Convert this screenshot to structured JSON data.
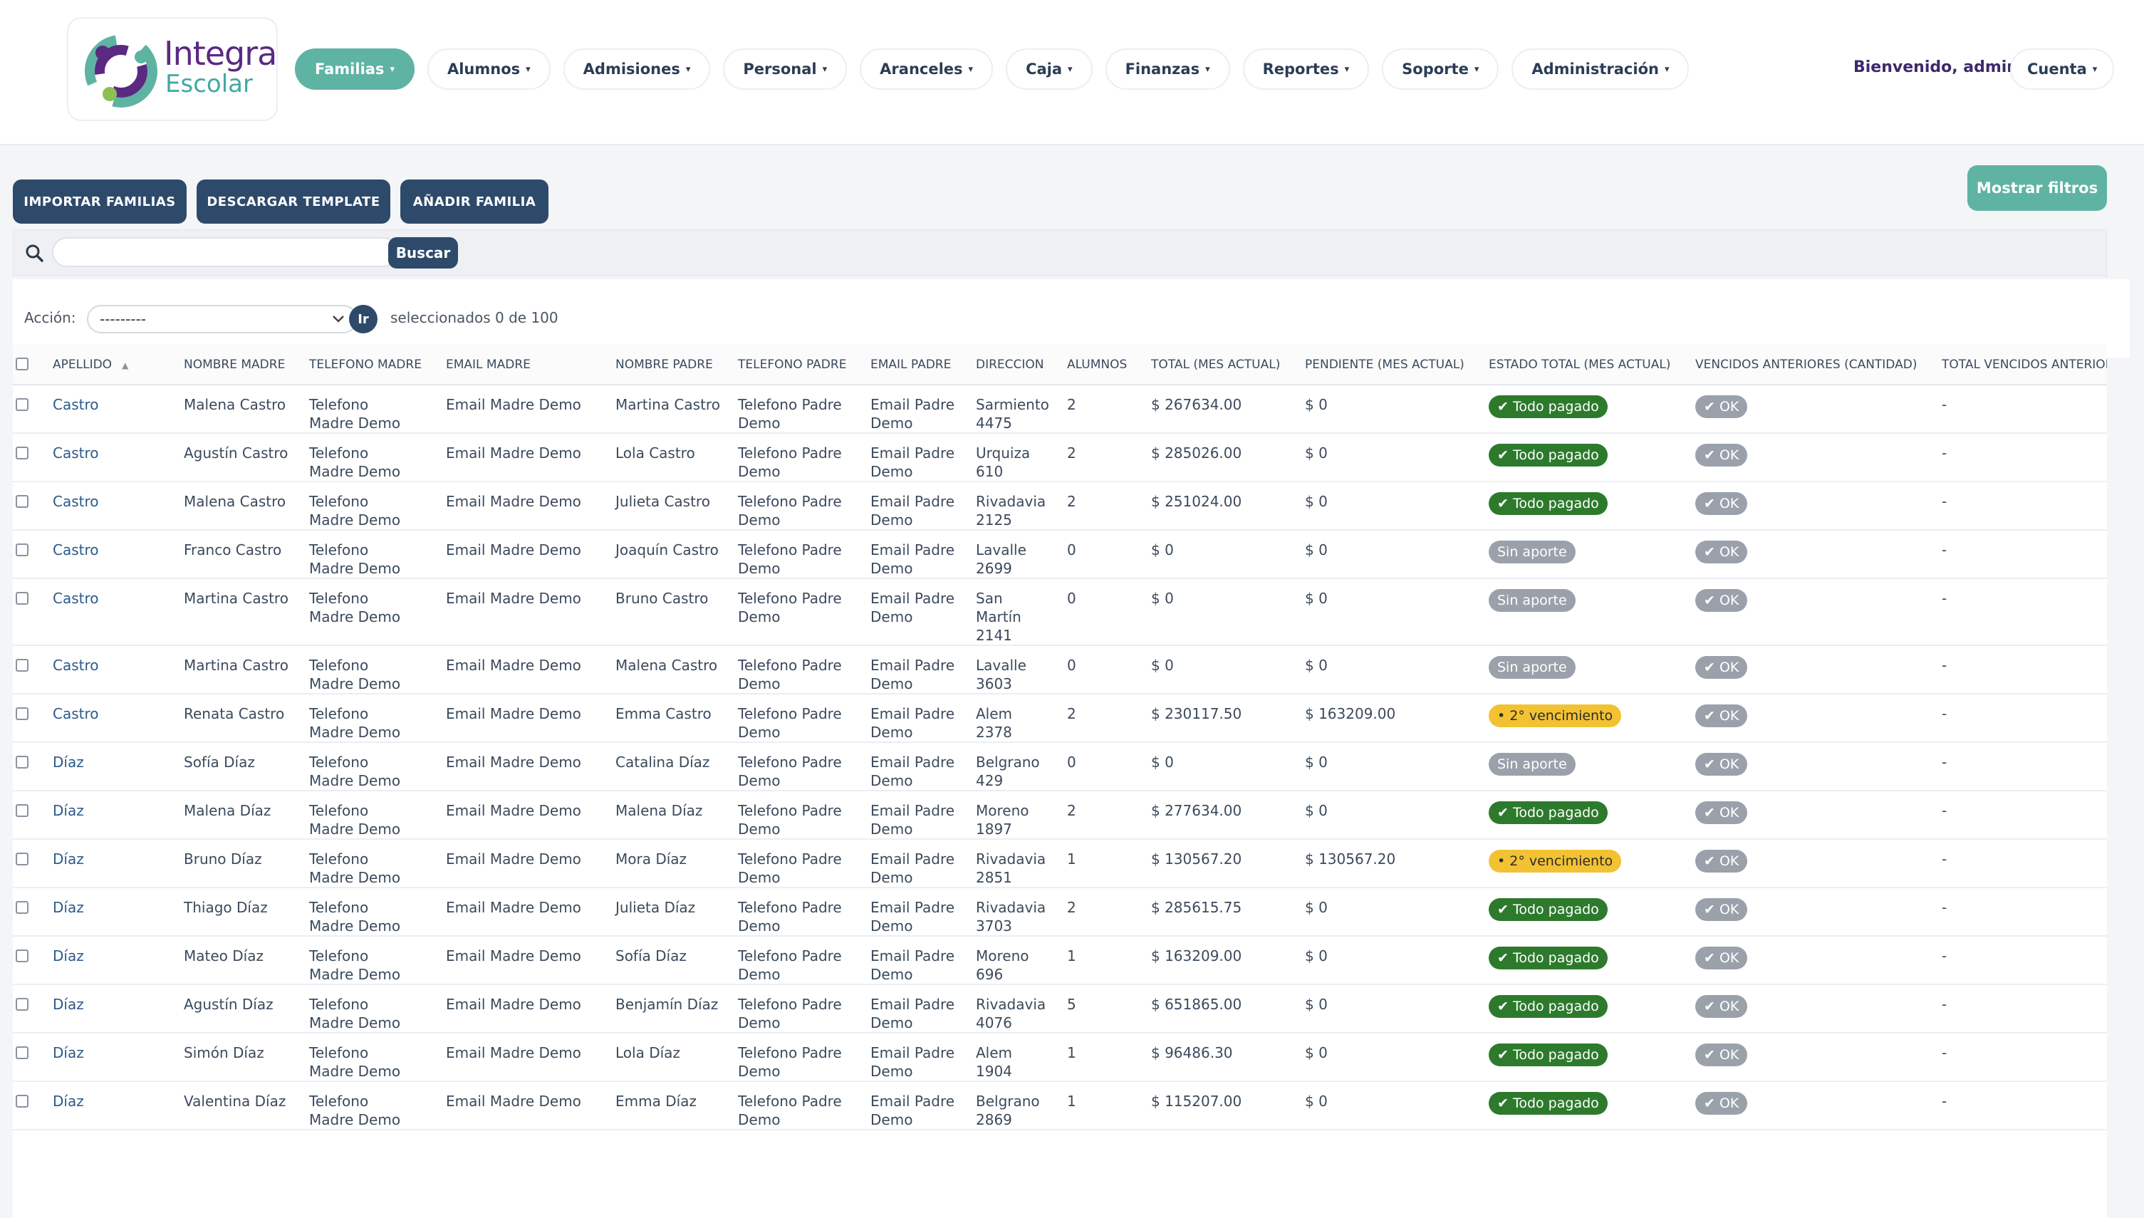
{
  "header": {
    "logo": {
      "line1": "Integra",
      "line2": "Escolar"
    },
    "nav": [
      {
        "label": "Familias",
        "active": true
      },
      {
        "label": "Alumnos"
      },
      {
        "label": "Admisiones"
      },
      {
        "label": "Personal"
      },
      {
        "label": "Aranceles"
      },
      {
        "label": "Caja"
      },
      {
        "label": "Finanzas"
      },
      {
        "label": "Reportes"
      },
      {
        "label": "Soporte"
      },
      {
        "label": "Administración"
      }
    ],
    "caret": "▾",
    "welcome": "Bienvenido, admin",
    "account": "Cuenta"
  },
  "toolbar": {
    "import": "IMPORTAR FAMILIAS",
    "template": "DESCARGAR TEMPLATE",
    "add": "AÑADIR FAMILIA",
    "filters": "Mostrar filtros"
  },
  "search": {
    "placeholder": "",
    "button": "Buscar"
  },
  "actions": {
    "label": "Acción:",
    "select_value": "---------",
    "go": "Ir",
    "selected": "seleccionados 0 de 100"
  },
  "table": {
    "columns": [
      "Apellido",
      "Nombre madre",
      "Telefono madre",
      "Email madre",
      "Nombre padre",
      "Telefono padre",
      "Email padre",
      "Direccion",
      "Alumnos",
      "Total (mes actual)",
      "Pendiente (mes actual)",
      "Estado total (mes actual)",
      "Vencidos anteriores (cantidad)",
      "Total vencidos anteriores"
    ],
    "rows": [
      {
        "apellido": "Castro",
        "madre": "Malena Castro",
        "tel_madre": "Telefono Madre Demo",
        "email_madre": "Email Madre Demo",
        "padre": "Martina Castro",
        "tel_padre": "Telefono Padre Demo",
        "email_padre": "Email Padre Demo",
        "direccion": "Sarmiento 4475",
        "alumnos": "2",
        "total": "$ 267634.00",
        "pendiente": "$ 0",
        "estado": "✔ Todo pagado",
        "estado_type": "green",
        "vencidos": "✔ OK",
        "total_vencidos": "-"
      },
      {
        "apellido": "Castro",
        "madre": "Agustín Castro",
        "tel_madre": "Telefono Madre Demo",
        "email_madre": "Email Madre Demo",
        "padre": "Lola Castro",
        "tel_padre": "Telefono Padre Demo",
        "email_padre": "Email Padre Demo",
        "direccion": "Urquiza 610",
        "alumnos": "2",
        "total": "$ 285026.00",
        "pendiente": "$ 0",
        "estado": "✔ Todo pagado",
        "estado_type": "green",
        "vencidos": "✔ OK",
        "total_vencidos": "-"
      },
      {
        "apellido": "Castro",
        "madre": "Malena Castro",
        "tel_madre": "Telefono Madre Demo",
        "email_madre": "Email Madre Demo",
        "padre": "Julieta Castro",
        "tel_padre": "Telefono Padre Demo",
        "email_padre": "Email Padre Demo",
        "direccion": "Rivadavia 2125",
        "alumnos": "2",
        "total": "$ 251024.00",
        "pendiente": "$ 0",
        "estado": "✔ Todo pagado",
        "estado_type": "green",
        "vencidos": "✔ OK",
        "total_vencidos": "-"
      },
      {
        "apellido": "Castro",
        "madre": "Franco Castro",
        "tel_madre": "Telefono Madre Demo",
        "email_madre": "Email Madre Demo",
        "padre": "Joaquín Castro",
        "tel_padre": "Telefono Padre Demo",
        "email_padre": "Email Padre Demo",
        "direccion": "Lavalle 2699",
        "alumnos": "0",
        "total": "$ 0",
        "pendiente": "$ 0",
        "estado": "Sin aporte",
        "estado_type": "gray",
        "vencidos": "✔ OK",
        "total_vencidos": "-"
      },
      {
        "apellido": "Castro",
        "madre": "Martina Castro",
        "tel_madre": "Telefono Madre Demo",
        "email_madre": "Email Madre Demo",
        "padre": "Bruno Castro",
        "tel_padre": "Telefono Padre Demo",
        "email_padre": "Email Padre Demo",
        "direccion": "San Martín 2141",
        "alumnos": "0",
        "total": "$ 0",
        "pendiente": "$ 0",
        "estado": "Sin aporte",
        "estado_type": "gray",
        "vencidos": "✔ OK",
        "total_vencidos": "-"
      },
      {
        "apellido": "Castro",
        "madre": "Martina Castro",
        "tel_madre": "Telefono Madre Demo",
        "email_madre": "Email Madre Demo",
        "padre": "Malena Castro",
        "tel_padre": "Telefono Padre Demo",
        "email_padre": "Email Padre Demo",
        "direccion": "Lavalle 3603",
        "alumnos": "0",
        "total": "$ 0",
        "pendiente": "$ 0",
        "estado": "Sin aporte",
        "estado_type": "gray",
        "vencidos": "✔ OK",
        "total_vencidos": "-"
      },
      {
        "apellido": "Castro",
        "madre": "Renata Castro",
        "tel_madre": "Telefono Madre Demo",
        "email_madre": "Email Madre Demo",
        "padre": "Emma Castro",
        "tel_padre": "Telefono Padre Demo",
        "email_padre": "Email Padre Demo",
        "direccion": "Alem 2378",
        "alumnos": "2",
        "total": "$ 230117.50",
        "pendiente": "$ 163209.00",
        "estado": "• 2° vencimiento",
        "estado_type": "yellow",
        "vencidos": "✔ OK",
        "total_vencidos": "-"
      },
      {
        "apellido": "Díaz",
        "madre": "Sofía Díaz",
        "tel_madre": "Telefono Madre Demo",
        "email_madre": "Email Madre Demo",
        "padre": "Catalina Díaz",
        "tel_padre": "Telefono Padre Demo",
        "email_padre": "Email Padre Demo",
        "direccion": "Belgrano 429",
        "alumnos": "0",
        "total": "$ 0",
        "pendiente": "$ 0",
        "estado": "Sin aporte",
        "estado_type": "gray",
        "vencidos": "✔ OK",
        "total_vencidos": "-"
      },
      {
        "apellido": "Díaz",
        "madre": "Malena Díaz",
        "tel_madre": "Telefono Madre Demo",
        "email_madre": "Email Madre Demo",
        "padre": "Malena Díaz",
        "tel_padre": "Telefono Padre Demo",
        "email_padre": "Email Padre Demo",
        "direccion": "Moreno 1897",
        "alumnos": "2",
        "total": "$ 277634.00",
        "pendiente": "$ 0",
        "estado": "✔ Todo pagado",
        "estado_type": "green",
        "vencidos": "✔ OK",
        "total_vencidos": "-"
      },
      {
        "apellido": "Díaz",
        "madre": "Bruno Díaz",
        "tel_madre": "Telefono Madre Demo",
        "email_madre": "Email Madre Demo",
        "padre": "Mora Díaz",
        "tel_padre": "Telefono Padre Demo",
        "email_padre": "Email Padre Demo",
        "direccion": "Rivadavia 2851",
        "alumnos": "1",
        "total": "$ 130567.20",
        "pendiente": "$ 130567.20",
        "estado": "• 2° vencimiento",
        "estado_type": "yellow",
        "vencidos": "✔ OK",
        "total_vencidos": "-"
      },
      {
        "apellido": "Díaz",
        "madre": "Thiago Díaz",
        "tel_madre": "Telefono Madre Demo",
        "email_madre": "Email Madre Demo",
        "padre": "Julieta Díaz",
        "tel_padre": "Telefono Padre Demo",
        "email_padre": "Email Padre Demo",
        "direccion": "Rivadavia 3703",
        "alumnos": "2",
        "total": "$ 285615.75",
        "pendiente": "$ 0",
        "estado": "✔ Todo pagado",
        "estado_type": "green",
        "vencidos": "✔ OK",
        "total_vencidos": "-"
      },
      {
        "apellido": "Díaz",
        "madre": "Mateo Díaz",
        "tel_madre": "Telefono Madre Demo",
        "email_madre": "Email Madre Demo",
        "padre": "Sofía Díaz",
        "tel_padre": "Telefono Padre Demo",
        "email_padre": "Email Padre Demo",
        "direccion": "Moreno 696",
        "alumnos": "1",
        "total": "$ 163209.00",
        "pendiente": "$ 0",
        "estado": "✔ Todo pagado",
        "estado_type": "green",
        "vencidos": "✔ OK",
        "total_vencidos": "-"
      },
      {
        "apellido": "Díaz",
        "madre": "Agustín Díaz",
        "tel_madre": "Telefono Madre Demo",
        "email_madre": "Email Madre Demo",
        "padre": "Benjamín Díaz",
        "tel_padre": "Telefono Padre Demo",
        "email_padre": "Email Padre Demo",
        "direccion": "Rivadavia 4076",
        "alumnos": "5",
        "total": "$ 651865.00",
        "pendiente": "$ 0",
        "estado": "✔ Todo pagado",
        "estado_type": "green",
        "vencidos": "✔ OK",
        "total_vencidos": "-"
      },
      {
        "apellido": "Díaz",
        "madre": "Simón Díaz",
        "tel_madre": "Telefono Madre Demo",
        "email_madre": "Email Madre Demo",
        "padre": "Lola Díaz",
        "tel_padre": "Telefono Padre Demo",
        "email_padre": "Email Padre Demo",
        "direccion": "Alem 1904",
        "alumnos": "1",
        "total": "$ 96486.30",
        "pendiente": "$ 0",
        "estado": "✔ Todo pagado",
        "estado_type": "green",
        "vencidos": "✔ OK",
        "total_vencidos": "-"
      },
      {
        "apellido": "Díaz",
        "madre": "Valentina Díaz",
        "tel_madre": "Telefono Madre Demo",
        "email_madre": "Email Madre Demo",
        "padre": "Emma Díaz",
        "tel_padre": "Telefono Padre Demo",
        "email_padre": "Email Padre Demo",
        "direccion": "Belgrano 2869",
        "alumnos": "1",
        "total": "$ 115207.00",
        "pendiente": "$ 0",
        "estado": "✔ Todo pagado",
        "estado_type": "green",
        "vencidos": "✔ OK",
        "total_vencidos": "-"
      }
    ]
  },
  "colors": {
    "brand_purple": "#5a2a82",
    "brand_teal": "#5fb3a3",
    "primary_navy": "#2e4a6b",
    "badge_green": "#2d7a2d",
    "badge_gray": "#9aa1aa",
    "badge_yellow": "#f2c233"
  },
  "icons": {
    "search": "search-icon",
    "caret": "chevron-down-icon",
    "sort": "sort-asc-icon"
  }
}
